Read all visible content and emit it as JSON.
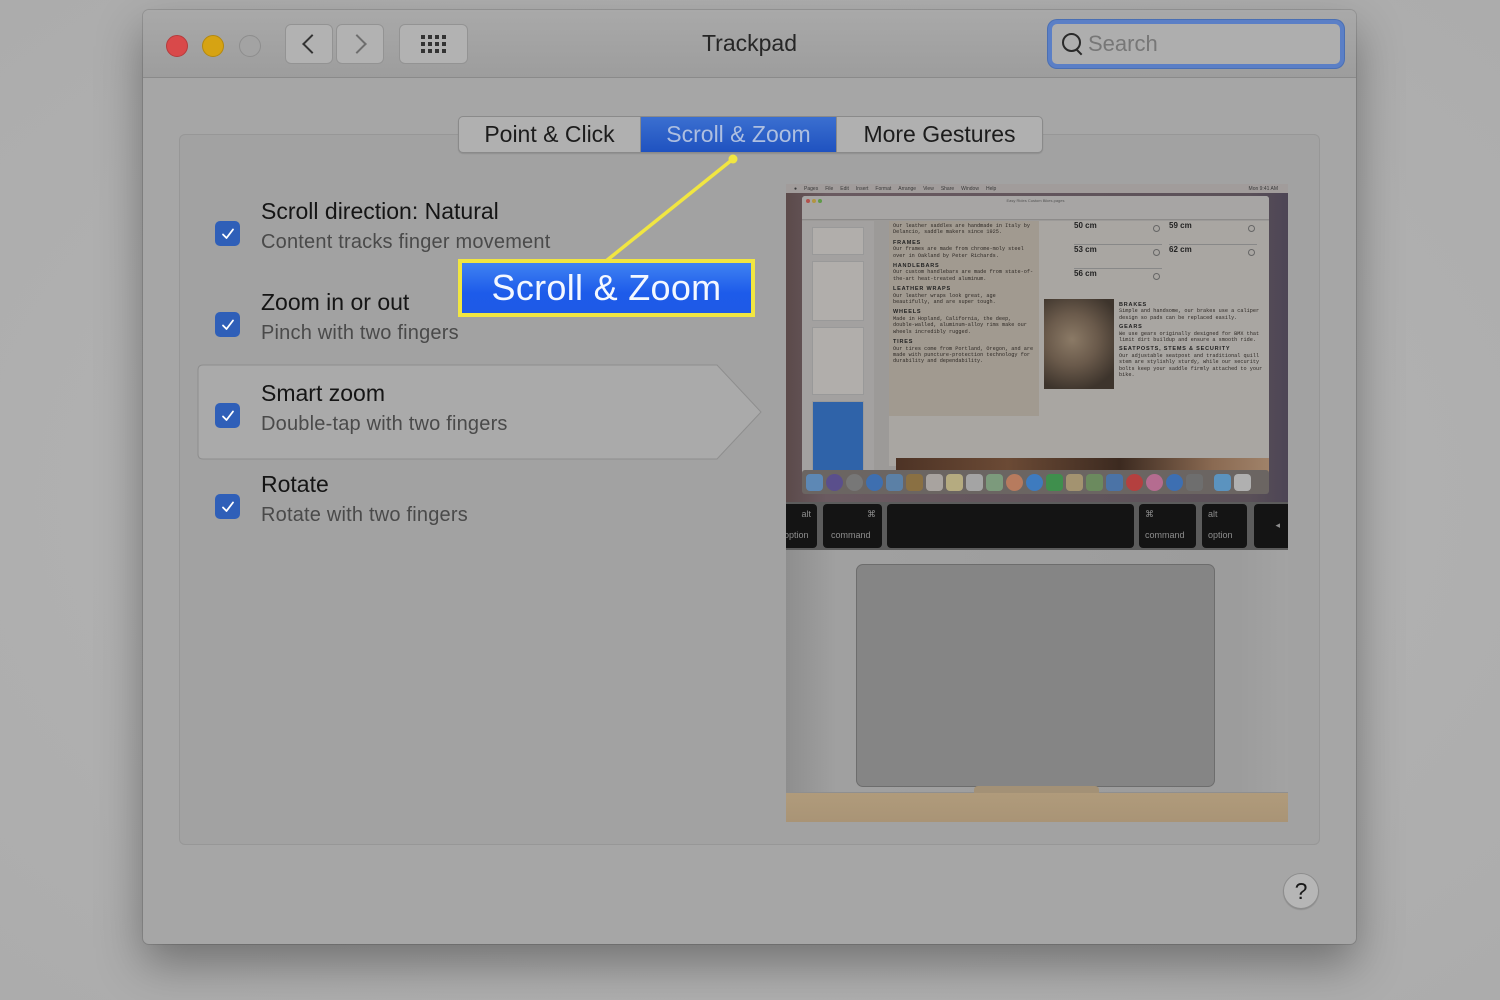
{
  "window": {
    "title": "Trackpad",
    "traffic_lights": [
      "close",
      "minimize",
      "zoom-disabled"
    ],
    "nav": {
      "back_icon": "chevron-left-icon",
      "forward_icon": "chevron-right-icon",
      "grid_icon": "show-all-grid-icon"
    }
  },
  "search": {
    "placeholder": "Search",
    "value": "",
    "focused": true,
    "focus_color": "#5b7fc6"
  },
  "tabs": [
    {
      "label": "Point & Click",
      "active": false
    },
    {
      "label": "Scroll & Zoom",
      "active": true
    },
    {
      "label": "More Gestures",
      "active": false
    }
  ],
  "options": [
    {
      "title": "Scroll direction: Natural",
      "subtitle": "Content tracks finger movement",
      "checked": true
    },
    {
      "title": "Zoom in or out",
      "subtitle": "Pinch with two fingers",
      "checked": true
    },
    {
      "title": "Smart zoom",
      "subtitle": "Double-tap with two fingers",
      "checked": true,
      "highlighted": true
    },
    {
      "title": "Rotate",
      "subtitle": "Rotate with two fingers",
      "checked": true
    }
  ],
  "annotation": {
    "label": "Scroll & Zoom",
    "border_color": "#f1e641",
    "fill_color": "#2a6cee"
  },
  "preview": {
    "menubar": {
      "items": [
        "Pages",
        "File",
        "Edit",
        "Insert",
        "Format",
        "Arrange",
        "View",
        "Share",
        "Window",
        "Help"
      ],
      "clock": "Mon 9:41 AM"
    },
    "document_title": "Easy Rides Custom Bikes.pages",
    "doc_sections": [
      {
        "heading": "",
        "text": "Our leather saddles are handmade in Italy by Delancio, saddle makers since 1925."
      },
      {
        "heading": "FRAMES",
        "text": "Our frames are made from chrome-moly steel over in Oakland by Peter Richards."
      },
      {
        "heading": "HANDLEBARS",
        "text": "Our custom handlebars are made from state-of-the-art heat-treated aluminum."
      },
      {
        "heading": "LEATHER WRAPS",
        "text": "Our leather wraps look great, age beautifully, and are super tough."
      },
      {
        "heading": "WHEELS",
        "text": "Made in Hopland, California, the deep, double-walled, aluminum-alloy rims make our wheels incredibly rugged."
      },
      {
        "heading": "TIRES",
        "text": "Our tires come from Portland, Oregon, and are made with puncture-protection technology for durability and dependability."
      }
    ],
    "right_sections": [
      {
        "heading": "BRAKES",
        "text": "Simple and handsome, our brakes use a caliper design so pads can be replaced easily."
      },
      {
        "heading": "GEARS",
        "text": "We use gears originally designed for BMX that limit dirt buildup and ensure a smooth ride."
      },
      {
        "heading": "SEATPOSTS, STEMS & SECURITY",
        "text": "Our adjustable seatpost and traditional quill stem are stylishly sturdy, while our security bolts keep your saddle firmly attached to your bike."
      }
    ],
    "sizes": [
      "50 cm",
      "53 cm",
      "56 cm",
      "59 cm",
      "62 cm"
    ],
    "keys": [
      {
        "symbol": "alt",
        "label": "option"
      },
      {
        "symbol": "⌘",
        "label": "command"
      },
      {
        "symbol": "",
        "label": ""
      },
      {
        "symbol": "⌘",
        "label": "command"
      },
      {
        "symbol": "alt",
        "label": "option"
      },
      {
        "symbol": "◂",
        "label": ""
      }
    ]
  },
  "help": {
    "label": "?"
  }
}
